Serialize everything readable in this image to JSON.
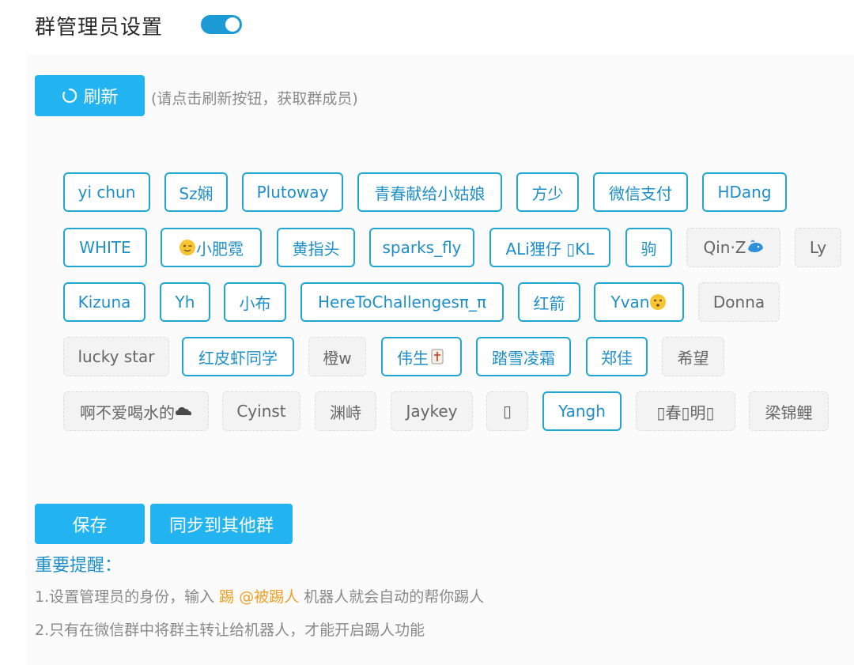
{
  "header": {
    "title": "群管理员设置",
    "toggle_on": true
  },
  "refresh": {
    "label": "刷新",
    "hint": "(请点击刷新按钮，获取群成员)"
  },
  "members": [
    {
      "name": "yi chun",
      "on": true
    },
    {
      "name": "Sz娴",
      "on": true
    },
    {
      "name": "Plutoway",
      "on": true
    },
    {
      "name": "青春献给小姑娘",
      "on": true
    },
    {
      "name": "方少",
      "on": true
    },
    {
      "name": "微信支付",
      "on": true
    },
    {
      "name": "HDang",
      "on": true
    },
    {
      "name": "WHITE",
      "on": true
    },
    {
      "name": "小肥霓",
      "on": true,
      "emoji_before": "wink-face-emoji"
    },
    {
      "name": "黄指头",
      "on": true
    },
    {
      "name": "sparks_fly",
      "on": true
    },
    {
      "name": "ALi狸仔 ▯KL",
      "on": true
    },
    {
      "name": "驹",
      "on": true
    },
    {
      "name": "Qin·Z",
      "on": false,
      "emoji_after": "whale-emoji"
    },
    {
      "name": "Ly",
      "on": false
    },
    {
      "name": "Kizuna",
      "on": true
    },
    {
      "name": "Yh",
      "on": true
    },
    {
      "name": "小布",
      "on": true
    },
    {
      "name": "HereToChallengesπ_π",
      "on": true
    },
    {
      "name": "红箭",
      "on": true
    },
    {
      "name": "Yvan",
      "on": true,
      "emoji_after": "neutral-face-emoji"
    },
    {
      "name": "Donna",
      "on": false
    },
    {
      "name": "lucky star",
      "on": false
    },
    {
      "name": "红皮虾同学",
      "on": true
    },
    {
      "name": "橙w",
      "on": false
    },
    {
      "name": "伟生",
      "on": true,
      "emoji_after": "mahjong-emoji"
    },
    {
      "name": "踏雪凌霜",
      "on": true
    },
    {
      "name": "郑佳",
      "on": true
    },
    {
      "name": "希望",
      "on": false
    },
    {
      "name": "啊不爱喝水的",
      "on": false,
      "emoji_after": "cloud-emoji"
    },
    {
      "name": "Cyinst",
      "on": false
    },
    {
      "name": "渊峙",
      "on": false
    },
    {
      "name": "Jaykey",
      "on": false
    },
    {
      "name": "▯",
      "on": false
    },
    {
      "name": "Yangh",
      "on": true
    },
    {
      "name": "▯春▯明▯",
      "on": false
    },
    {
      "name": "梁锦鲤",
      "on": false
    }
  ],
  "actions": {
    "save": "保存",
    "sync": "同步到其他群"
  },
  "notice": {
    "title": "重要提醒：",
    "line1_prefix": "1.设置管理员的身份，输入 ",
    "line1_highlight": "踢 @被踢人",
    "line1_suffix": " 机器人就会自动的帮你踢人",
    "line2": "2.只有在微信群中将群主转让给机器人，才能开启踢人功能"
  },
  "colors": {
    "accent": "#21b4f0",
    "tag_on_border": "#20a6d3",
    "tag_on_text": "#1e8fc8",
    "highlight": "#f0a026"
  }
}
